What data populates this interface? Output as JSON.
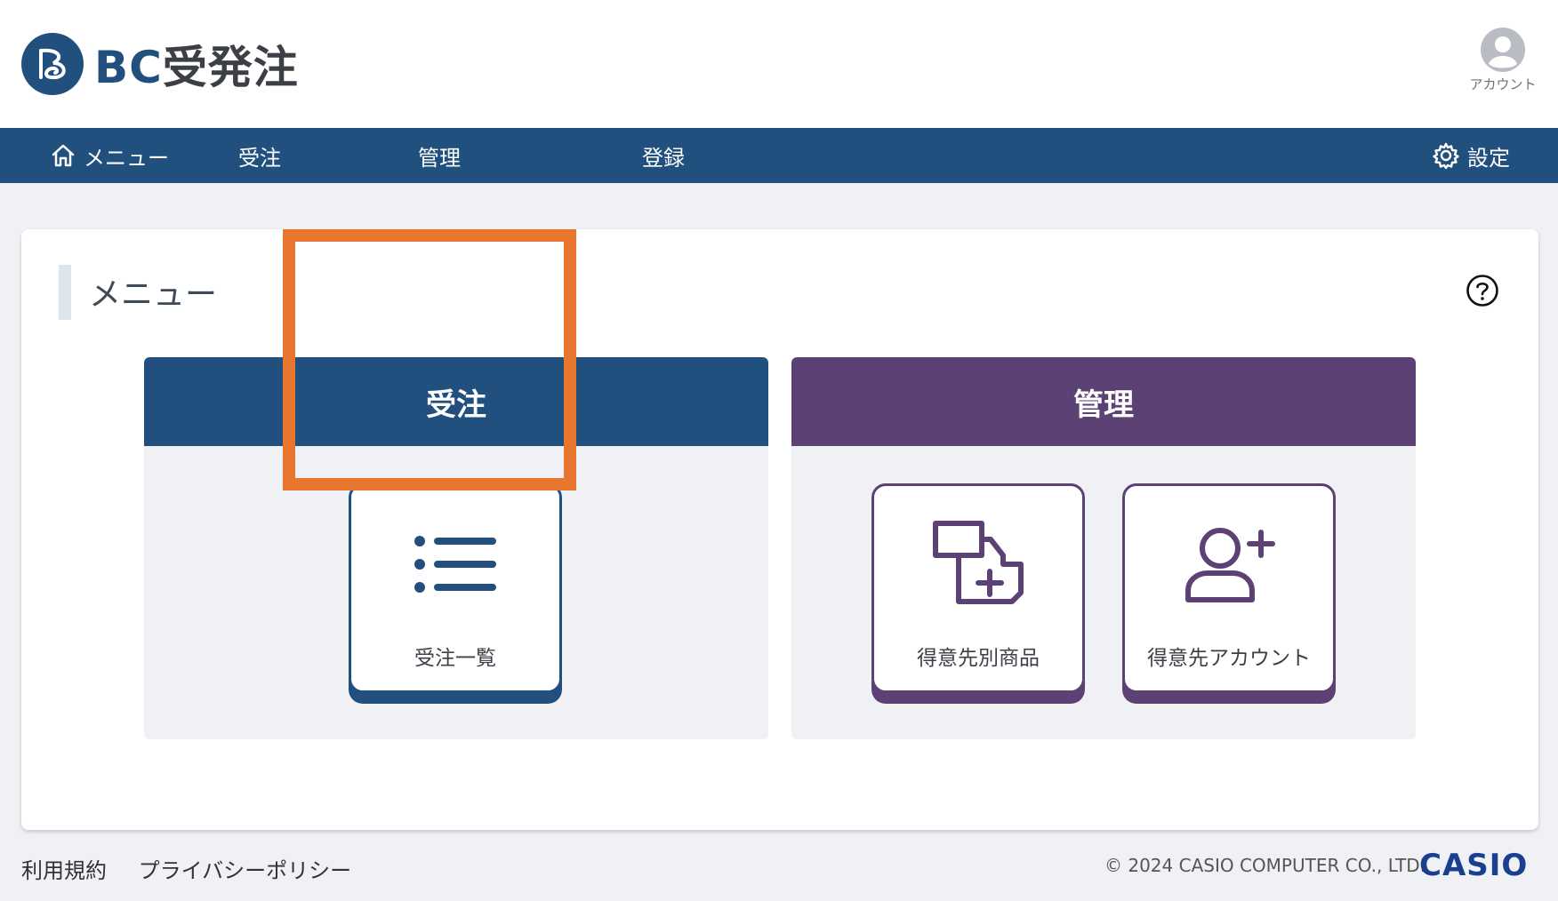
{
  "header": {
    "logo_text_bc": "BC",
    "logo_text_jp": "受発注",
    "account_label": "アカウント"
  },
  "nav": {
    "menu": "メニュー",
    "orders": "受注",
    "management": "管理",
    "register": "登録",
    "settings": "設定"
  },
  "main": {
    "section_title": "メニュー",
    "groups": [
      {
        "title": "受注",
        "color": "#22507e",
        "tiles": [
          {
            "label": "受注一覧",
            "icon": "list-icon"
          }
        ]
      },
      {
        "title": "管理",
        "color": "#5c4175",
        "tiles": [
          {
            "label": "得意先別商品",
            "icon": "customer-product-icon"
          },
          {
            "label": "得意先アカウント",
            "icon": "add-user-icon"
          }
        ]
      }
    ]
  },
  "footer": {
    "terms": "利用規約",
    "privacy": "プライバシーポリシー",
    "copyright": "© 2024 CASIO COMPUTER CO., LTD.",
    "brand": "CASIO"
  },
  "colors": {
    "primary": "#22507e",
    "purple": "#5c4175",
    "highlight": "#e8762f",
    "background": "#eff1f5"
  }
}
